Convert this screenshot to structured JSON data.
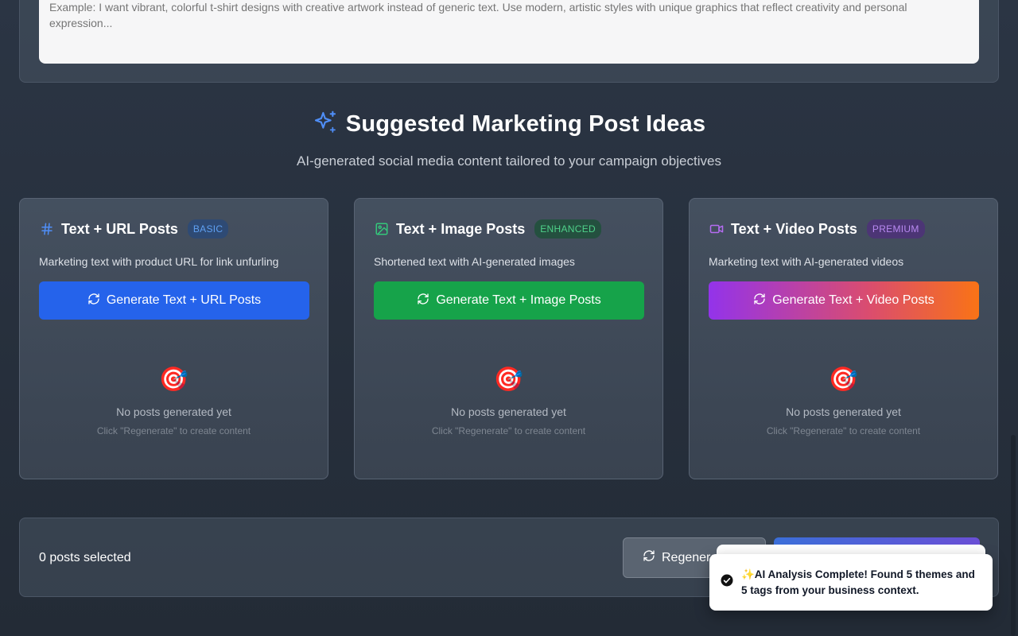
{
  "prompt": {
    "placeholder": "Example: I want vibrant, colorful t-shirt designs with creative artwork instead of generic text. Use modern, artistic styles with unique graphics that reflect creativity and personal expression..."
  },
  "section": {
    "title": "Suggested Marketing Post Ideas",
    "subtitle": "AI-generated social media content tailored to your campaign objectives",
    "icon": "sparkles-icon"
  },
  "cards": [
    {
      "title": "Text + URL Posts",
      "tier": "BASIC",
      "icon": "hash-icon",
      "description": "Marketing text with product URL for link unfurling",
      "button": "Generate Text + URL Posts",
      "empty_emoji": "🎯",
      "empty_title": "No posts generated yet",
      "empty_hint": "Click \"Regenerate\" to create content"
    },
    {
      "title": "Text + Image Posts",
      "tier": "ENHANCED",
      "icon": "image-icon",
      "description": "Shortened text with AI-generated images",
      "button": "Generate Text + Image Posts",
      "empty_emoji": "🎯",
      "empty_title": "No posts generated yet",
      "empty_hint": "Click \"Regenerate\" to create content"
    },
    {
      "title": "Text + Video Posts",
      "tier": "PREMIUM",
      "icon": "video-icon",
      "description": "Marketing text with AI-generated videos",
      "button": "Generate Text + Video Posts",
      "empty_emoji": "🎯",
      "empty_title": "No posts generated yet",
      "empty_hint": "Click \"Regenerate\" to create content"
    }
  ],
  "footer": {
    "selected": "0 posts selected",
    "regenerate_label": "Regenerate"
  },
  "toast": {
    "message": "✨AI Analysis Complete! Found 5 themes and 5 tags from your business context."
  },
  "colors": {
    "blue_button": "#2563eb",
    "green_button": "#16a34a",
    "premium_gradient_start": "#9333ea",
    "premium_gradient_end": "#f97316",
    "accent_sparkle": "#4f8ef7"
  }
}
